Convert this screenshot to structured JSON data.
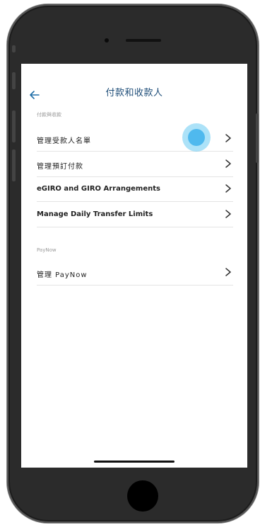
{
  "header": {
    "title": "付款和收款人",
    "back_icon": "arrow-left-icon"
  },
  "sections": [
    {
      "label": "付款與收款",
      "items": [
        {
          "label": "管理受款人名單"
        },
        {
          "label": "管理預訂付款"
        },
        {
          "label": "eGIRO and GIRO Arrangements"
        },
        {
          "label": "Manage Daily Transfer Limits"
        }
      ]
    },
    {
      "label": "PayNow",
      "items": [
        {
          "label": "管理 PayNow"
        }
      ]
    }
  ],
  "colors": {
    "title": "#1f4e79",
    "back_arrow": "#1f6fa8",
    "touch_indicator": "#4fb9ee",
    "device_frame": "#1c1c1c"
  }
}
